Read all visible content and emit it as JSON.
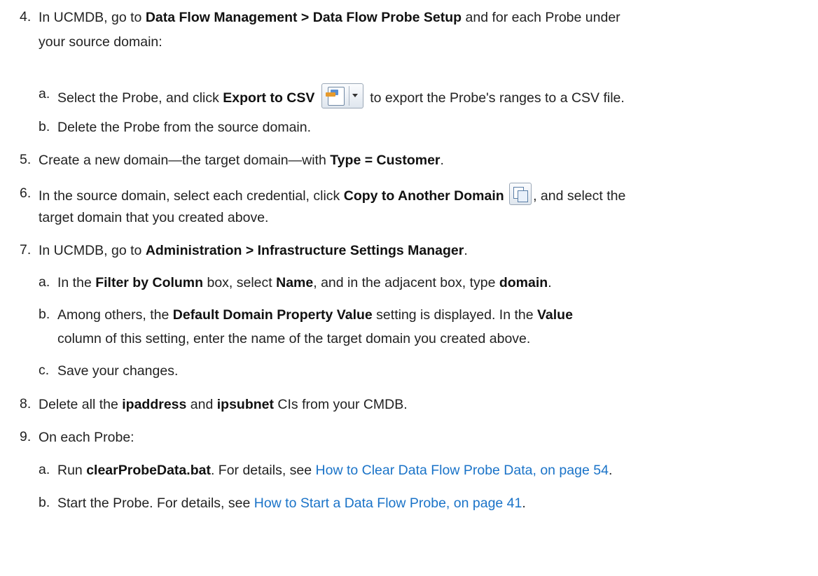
{
  "steps": {
    "s4": {
      "num": "4.",
      "l1": {
        "pre": "In UCMDB, go to ",
        "bold": "Data Flow Management > Data Flow Probe Setup",
        "post": " and for each Probe under"
      },
      "l2": "your source domain:",
      "a": {
        "num": "a.",
        "pre": "Select the Probe, and click ",
        "bold": "Export to CSV",
        "icon": "export-to-csv-icon",
        "post": " to export the Probe's ranges to a CSV file."
      },
      "b": {
        "num": "b.",
        "text": "Delete the Probe from the source domain."
      }
    },
    "s5": {
      "num": "5.",
      "pre": "Create a new domain—the target domain—with ",
      "bold": "Type = Customer",
      "post": "."
    },
    "s6": {
      "num": "6.",
      "l1": {
        "pre": "In the source domain, select each credential, click ",
        "bold": "Copy to Another Domain",
        "icon": "copy-to-another-domain-icon",
        "post": ", and select the"
      },
      "l2": "target domain that you created above."
    },
    "s7": {
      "num": "7.",
      "pre": "In UCMDB, go to ",
      "bold": "Administration > Infrastructure Settings Manager",
      "post": ".",
      "a": {
        "num": "a.",
        "t1": "In the ",
        "b1": "Filter by Column",
        "t2": " box, select ",
        "b2": "Name",
        "t3": ", and in the adjacent box, type ",
        "b3": "domain",
        "t4": "."
      },
      "b": {
        "num": "b.",
        "l1": {
          "t1": "Among others, the ",
          "b1": "Default Domain Property Value",
          "t2": " setting is displayed. In the ",
          "b2": "Value"
        },
        "l2": "column of this setting, enter the name of the target domain you created above."
      },
      "c": {
        "num": "c.",
        "text": "Save your changes."
      }
    },
    "s8": {
      "num": "8.",
      "t1": "Delete all the ",
      "b1": "ipaddress",
      "t2": " and ",
      "b2": "ipsubnet",
      "t3": " CIs from your CMDB."
    },
    "s9": {
      "num": "9.",
      "text": "On each Probe:",
      "a": {
        "num": "a.",
        "t1": "Run ",
        "b1": "clearProbeData.bat",
        "t2": ". For details, see ",
        "link": "How to Clear Data Flow Probe Data, on page 54",
        "t3": "."
      },
      "b": {
        "num": "b.",
        "t1": "Start the Probe. For details, see ",
        "link": "How to Start a Data Flow Probe, on page 41",
        "t2": "."
      }
    }
  },
  "colors": {
    "text": "#222222",
    "link": "#1a73c8"
  }
}
